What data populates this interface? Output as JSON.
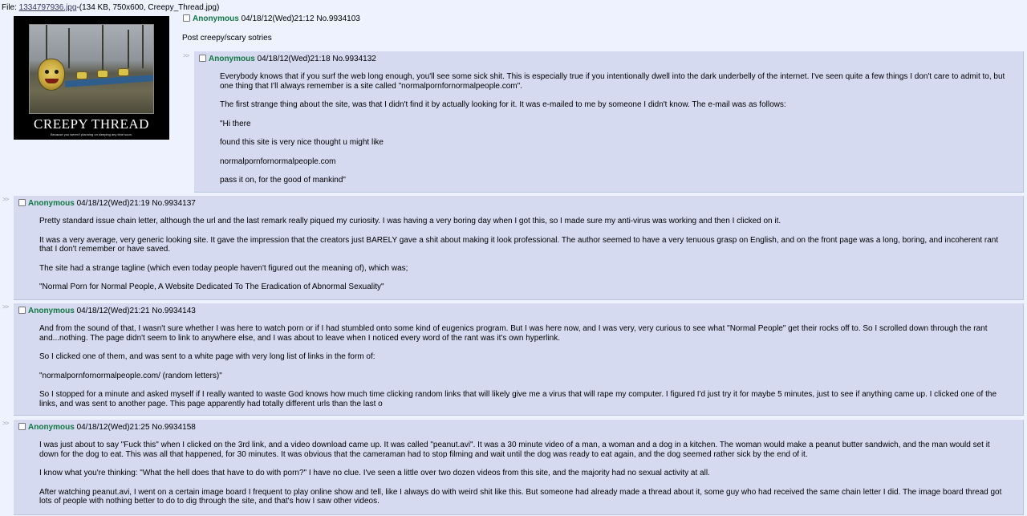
{
  "file": {
    "prefix": "File: ",
    "name": "1334797936.jpg",
    "meta": "-(134 KB, 750x600, Creepy_Thread.jpg)"
  },
  "thumbnail": {
    "caption": "CREEPY THREAD",
    "subcaption": "Because you weren't planning on sleeping any time soon."
  },
  "op": {
    "name": "Anonymous",
    "datetime": "04/18/12(Wed)21:12",
    "number": "No.9934103",
    "text": "Post creepy/scary sotries"
  },
  "replies": [
    {
      "name": "Anonymous",
      "datetime": "04/18/12(Wed)21:18",
      "number": "No.9934132",
      "paragraphs": [
        "Everybody knows that if you surf the web long enough, you'll see some sick shit. This is especially true if you intentionally dwell into the dark underbelly of the internet. I've seen quite a few things I don't care to admit to, but one thing that I'll always remember is a site called \"normalpornfornormalpeople.com\".",
        "The first strange thing about the site, was that I didn't find it by actually looking for it. It was e-mailed to me by someone I didn't know. The e-mail was as follows:",
        "\"Hi there",
        "found this site is very nice thought u might like",
        "normalpornfornormalpeople.com",
        "pass it on, for the good of mankind\""
      ]
    },
    {
      "name": "Anonymous",
      "datetime": "04/18/12(Wed)21:19",
      "number": "No.9934137",
      "paragraphs": [
        "Pretty standard issue chain letter, although the url and the last remark really piqued my curiosity. I was having a very boring day when I got this, so I made sure my anti-virus was working and then I clicked on it.",
        "It was a very average, very generic looking site. It gave the impression that the creators just BARELY gave a shit about making it look professional. The author seemed to have a very tenuous grasp on English, and on the front page was a long, boring, and incoherent rant that I don't remember or have saved.",
        "The site had a strange tagline (which even today people haven't figured out the meaning of), which was;",
        "\"Normal Porn for Normal People, A Website Dedicated To The Eradication of Abnormal Sexuality\""
      ]
    },
    {
      "name": "Anonymous",
      "datetime": "04/18/12(Wed)21:21",
      "number": "No.9934143",
      "paragraphs": [
        "And from the sound of that, I wasn't sure whether I was here to watch porn or if I had stumbled onto some kind of eugenics program. But I was here now, and I was very, very curious to see what \"Normal People\" get their rocks off to. So I scrolled down through the rant and...nothing. The page didn't seem to link to anywhere else, and I was about to leave when I noticed every word of the rant was it's own hyperlink.",
        "So I clicked one of them, and was sent to a white page with very long list of links in the form of:",
        "\"normalpornfornormalpeople.com/ (random letters)\"",
        "So I stopped for a minute and asked myself if I really wanted to waste God knows how much time clicking random links that will likely give me a virus that will rape my computer. I figured I'd just try it for maybe 5 minutes, just to see if anything came up. I clicked one of the links, and was sent to another page. This page apparently had totally different urls than the last o"
      ]
    },
    {
      "name": "Anonymous",
      "datetime": "04/18/12(Wed)21:25",
      "number": "No.9934158",
      "paragraphs": [
        "I was just about to say \"Fuck this\" when I clicked on the 3rd link, and a video download came up. It was called \"peanut.avi\". It was a 30 minute video of a man, a woman and a dog in a kitchen. The woman would make a peanut butter sandwich, and the man would set it down for the dog to eat. This was all that happened, for 30 minutes. It was obvious that the cameraman had to stop filming and wait until the dog was ready to eat again, and the dog seemed rather sick by the end of it.",
        "I know what you're thinking: \"What the hell does that have to do with porn?\" I have no clue. I've seen a little over two dozen videos from this site, and the majority had no sexual activity at all.",
        "After watching peanut.avi, I went on a certain image board I frequent to play online show and tell, like I always do with weird shit like this. But someone had already made a thread about it, some guy who had received the same chain letter I did. The image board thread got lots of people with nothing better to do to dig through the site, and that's how I saw other videos."
      ]
    }
  ],
  "quote_arrows": ">>"
}
